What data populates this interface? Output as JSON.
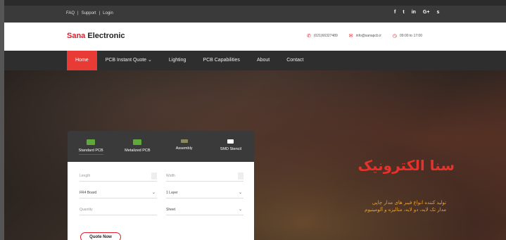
{
  "topbar": {
    "links": [
      "FAQ",
      "|",
      "Support",
      "|",
      "Login"
    ],
    "social": [
      "f",
      "t",
      "in",
      "G+",
      "s"
    ]
  },
  "header": {
    "logo_part1": "Sana",
    "logo_part2": " Electronic",
    "contacts": [
      {
        "icon": "phone-icon",
        "text": "(021)66327489"
      },
      {
        "icon": "mail-icon",
        "text": "info@sanapcb.ir"
      },
      {
        "icon": "clock-icon",
        "text": "09:00 to 17:00"
      }
    ]
  },
  "nav": {
    "items": [
      "Home",
      "PCB Instant Quote ⌄",
      "Lighting",
      "PCB Capabilities",
      "About",
      "Contact"
    ]
  },
  "hero": {
    "title": "سنا الکترونیک",
    "subtitle_line1": "تولید کننده انواع فیبر های مدار چاپی",
    "subtitle_line2": "مدار تک لایه، دو لایه، متالیزه و آلومینیوم"
  },
  "quote_card": {
    "tabs": [
      "Standard PCB",
      "Metalized PCB",
      "Assembly",
      "SMD Stencil"
    ],
    "fields": {
      "length_placeholder": "Length",
      "width_placeholder": "Width",
      "material_value": "FR4 Board",
      "layers_value": "1 Layer",
      "quantity_placeholder": "Quantity",
      "type_value": "Sheet"
    },
    "button_label": "Quote Now"
  },
  "colors": {
    "accent": "#e11d2b",
    "nav_active": "#e83b35",
    "subtitle": "#f0a020"
  }
}
